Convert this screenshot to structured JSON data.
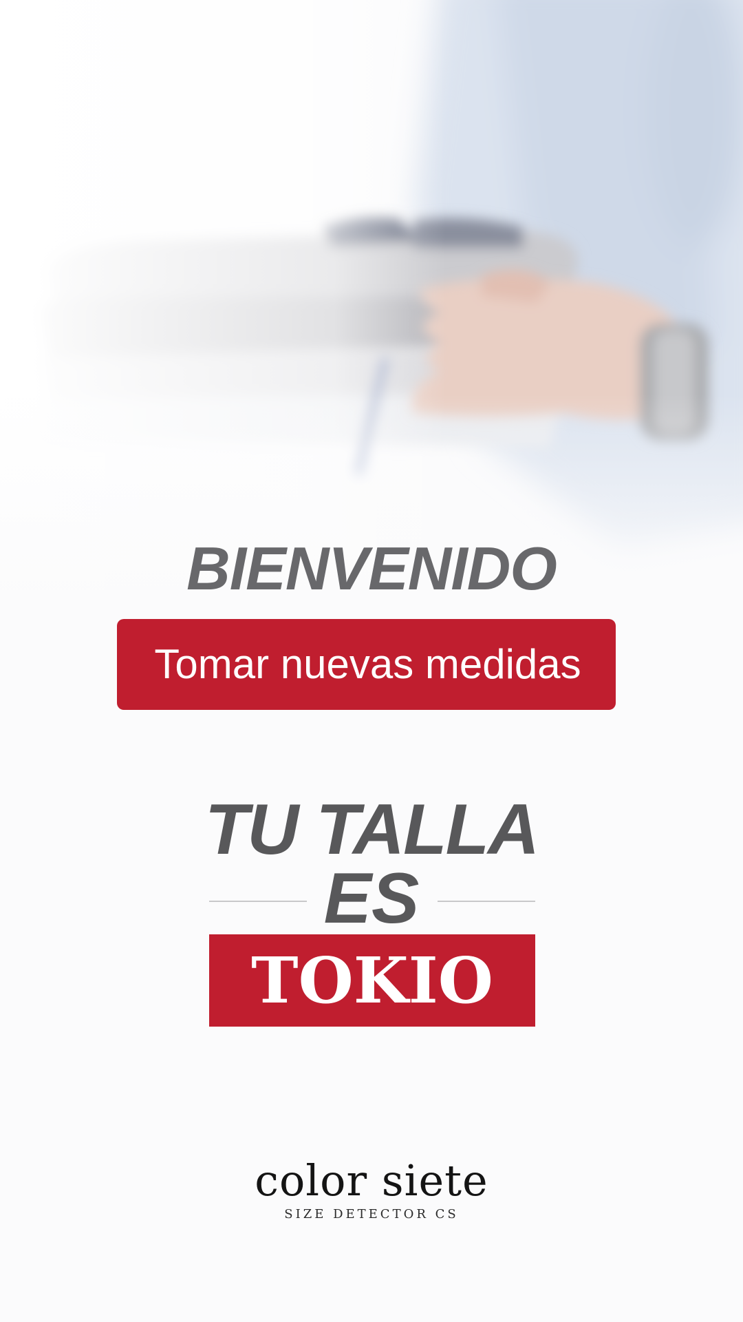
{
  "welcome": {
    "title": "BIENVENIDO"
  },
  "actions": {
    "new_measurements_label": "Tomar nuevas medidas"
  },
  "result": {
    "line1": "TU TALLA",
    "line2": "ES",
    "size_name": "TOKIO"
  },
  "brand": {
    "name": "color siete",
    "tagline": "SIZE DETECTOR CS"
  },
  "hero": {
    "image_icon": "folded-shirts-photo"
  },
  "colors": {
    "accent": "#c01e2f",
    "heading": "#58585a",
    "background": "#fbfbfc"
  }
}
